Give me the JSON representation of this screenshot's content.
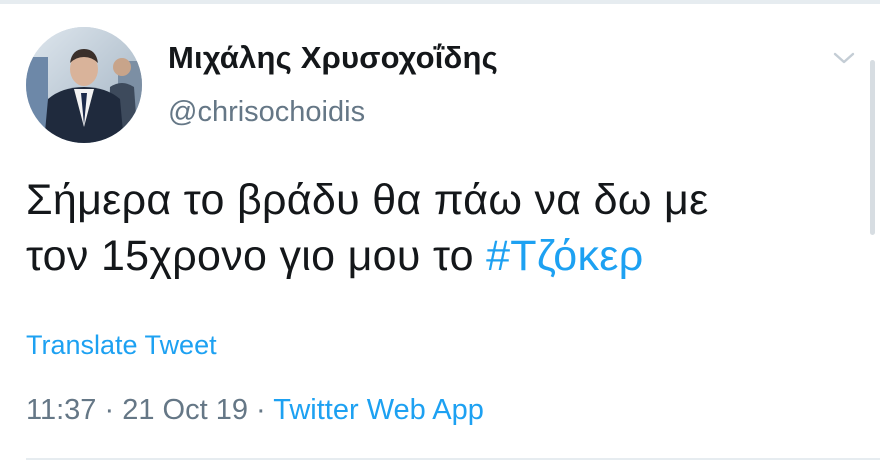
{
  "tweet": {
    "author": {
      "display_name": "Μιχάλης Χρυσοχοΐδης",
      "handle": "@chrisochoidis",
      "avatar_icon": "profile-photo"
    },
    "text_line1": "Σήμερα το βράδυ θα πάω να δω με",
    "text_line2_prefix": "τον 15χρονο γιο μου το ",
    "hashtag": "#Τζόκερ",
    "translate_label": "Translate Tweet",
    "time": "11:37",
    "separator": "·",
    "date": "21 Oct 19",
    "source": "Twitter Web App",
    "menu_icon": "chevron-down-icon"
  },
  "colors": {
    "link": "#1da1f2",
    "secondary_text": "#657786",
    "primary_text": "#14171a",
    "divider": "#e6ecf0"
  }
}
